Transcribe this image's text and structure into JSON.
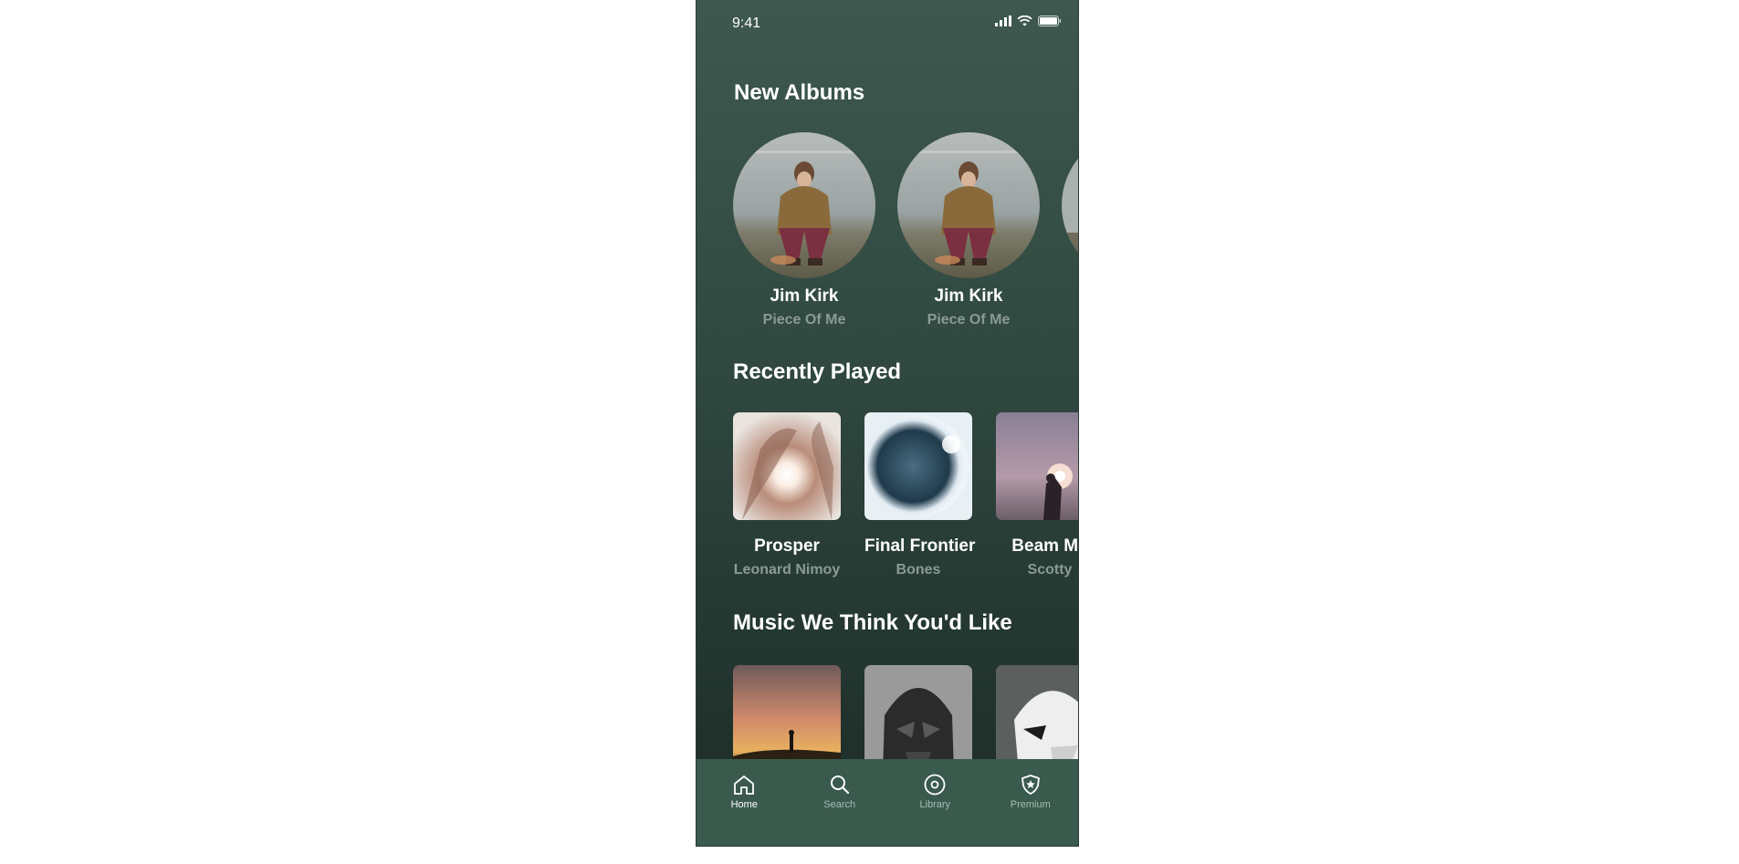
{
  "status": {
    "time": "9:41"
  },
  "new_albums": {
    "title": "New Albums",
    "items": [
      {
        "artist": "Jim Kirk",
        "album": "Piece Of Me"
      },
      {
        "artist": "Jim Kirk",
        "album": "Piece Of Me"
      },
      {
        "artist": "",
        "album": ""
      }
    ]
  },
  "recently_played": {
    "title": "Recently Played",
    "items": [
      {
        "title": "Prosper",
        "artist": "Leonard Nimoy"
      },
      {
        "title": "Final Frontier",
        "artist": "Bones"
      },
      {
        "title": "Beam Me",
        "artist": "Scotty"
      }
    ]
  },
  "recommended": {
    "title": "Music We Think You'd Like"
  },
  "tabbar": {
    "tabs": [
      {
        "label": "Home",
        "icon": "home-icon",
        "active": true
      },
      {
        "label": "Search",
        "icon": "search-icon",
        "active": false
      },
      {
        "label": "Library",
        "icon": "disc-icon",
        "active": false
      },
      {
        "label": "Premium",
        "icon": "shield-star-icon",
        "active": false
      }
    ]
  },
  "colors": {
    "background_top": "#3e584f",
    "background_bottom": "#1c2a26",
    "tabbar": "#3a5a4d",
    "subtext": "#8b9a95",
    "tab_inactive": "#a9bcb4"
  }
}
